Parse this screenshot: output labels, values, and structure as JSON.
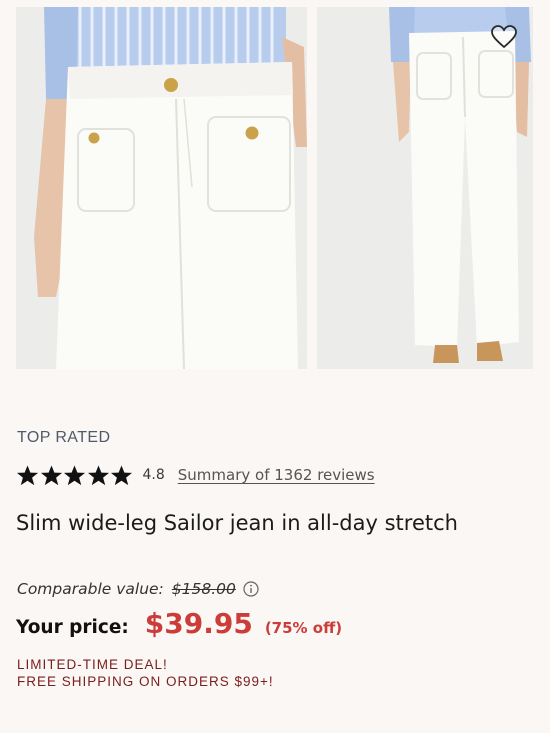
{
  "product": {
    "badge": "TOP RATED",
    "rating": "4.8",
    "rating_stars": 4.8,
    "reviews_link": "Summary of 1362 reviews",
    "title": "Slim wide-leg Sailor jean in all-day stretch"
  },
  "pricing": {
    "comparable_label": "Comparable value:",
    "comparable_price": "$158.00",
    "your_price_label": "Your price:",
    "price": "$39.95",
    "discount": "(75% off)"
  },
  "promo": {
    "line1": "LIMITED-TIME DEAL!",
    "line2": "FREE SHIPPING ON ORDERS $99+!"
  },
  "icons": {
    "wishlist": "heart-outline-icon",
    "info": "info-circle-icon",
    "star": "star-filled-icon"
  },
  "colors": {
    "price_red": "#cc3d3a",
    "deal_text": "#7a1e1e",
    "badge_text": "#4f5b6b",
    "background": "#faf7f4"
  }
}
